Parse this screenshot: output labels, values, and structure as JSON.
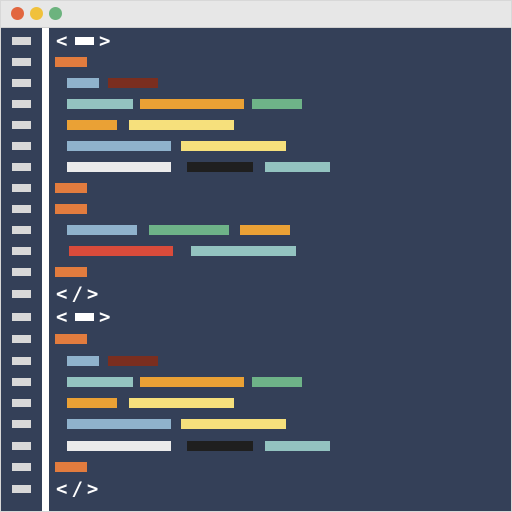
{
  "window": {
    "controls": [
      {
        "name": "close-button",
        "color": "#e2663f"
      },
      {
        "name": "minimize-button",
        "color": "#f0c13b"
      },
      {
        "name": "maximize-button",
        "color": "#6cb37e"
      }
    ]
  },
  "colors": {
    "background": "#344058",
    "gutter_marker": "#d8d8d8",
    "orange": "#e27c3e",
    "light_blue": "#8fb2cc",
    "brown": "#7a2e1f",
    "teal": "#93c3c0",
    "amber": "#eaa135",
    "green": "#6eb388",
    "yellow": "#f6e07c",
    "white": "#ebebeb",
    "black": "#1f1f1f",
    "red": "#d94b3b",
    "tag_white": "#ffffff"
  },
  "glyphs": {
    "open_tag_left": "<",
    "open_tag_right": ">",
    "close_tag": "</>"
  }
}
